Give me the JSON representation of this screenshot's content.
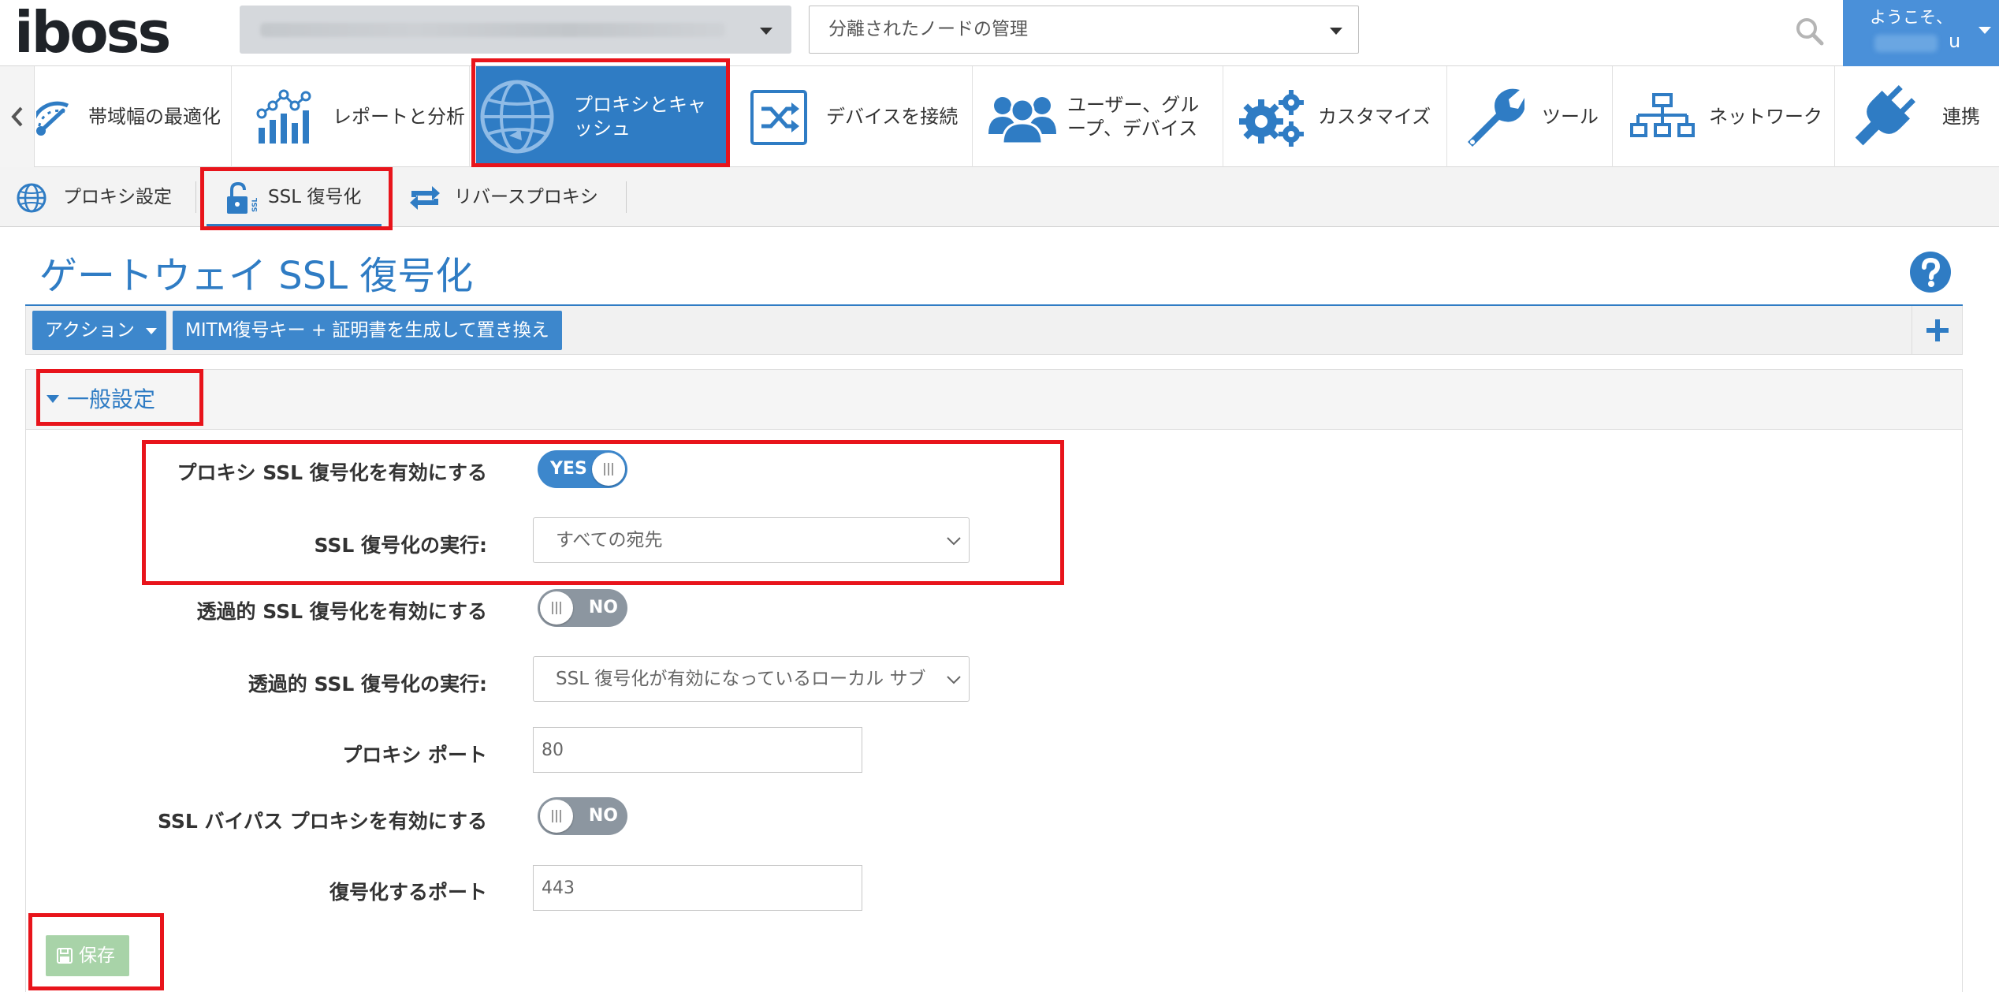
{
  "brand": {
    "logo_text": "iboss"
  },
  "header": {
    "node_select_value": "",
    "mgmt_select_value": "分離されたノードの管理",
    "welcome": "ようこそ、",
    "user_name_suffix": "u"
  },
  "main_nav": {
    "items": [
      {
        "label": "帯域幅の最適化",
        "icon": "gauge-icon"
      },
      {
        "label": "レポートと分析",
        "icon": "bar-chart-icon"
      },
      {
        "label": "プロキシとキャッシュ",
        "icon": "globe-icon",
        "active": true
      },
      {
        "label": "デバイスを接続",
        "icon": "shuffle-icon"
      },
      {
        "label": "ユーザー、グループ、デバイス",
        "icon": "users-icon"
      },
      {
        "label": "カスタマイズ",
        "icon": "gears-icon"
      },
      {
        "label": "ツール",
        "icon": "wrench-icon"
      },
      {
        "label": "ネットワーク",
        "icon": "network-icon"
      },
      {
        "label": "連携",
        "icon": "plug-icon"
      }
    ],
    "label_lines": {
      "proxy_1": "プロキシとキャ",
      "proxy_2": "ッシュ",
      "users_1": "ユーザー、グル",
      "users_2": "ープ、デバイス"
    }
  },
  "sub_nav": {
    "items": [
      {
        "label": "プロキシ設定",
        "icon": "globe-icon"
      },
      {
        "label": "SSL 復号化",
        "icon": "ssl-lock-icon",
        "active": true
      },
      {
        "label": "リバースプロキシ",
        "icon": "refresh-arrows-icon"
      }
    ]
  },
  "page": {
    "title": "ゲートウェイ SSL 復号化",
    "toolbar": {
      "actions_label": "アクション",
      "mitm_label": "MITM復号キー + 証明書を生成して置き換え"
    },
    "panel_title": "一般設定",
    "fields": {
      "proxy_ssl": {
        "label": "プロキシ SSL 復号化を有効にする",
        "toggle": "YES"
      },
      "ssl_exec": {
        "label": "SSL 復号化の実行:",
        "value": "すべての宛先"
      },
      "transparent_ssl": {
        "label": "透過的 SSL 復号化を有効にする",
        "toggle": "NO"
      },
      "transparent_exec": {
        "label": "透過的 SSL 復号化の実行:",
        "value": "SSL 復号化が有効になっているローカル サブ"
      },
      "proxy_port": {
        "label": "プロキシ ポート",
        "value": "80"
      },
      "ssl_bypass": {
        "label": "SSL バイパス プロキシを有効にする",
        "toggle": "NO"
      },
      "decrypt_port": {
        "label": "復号化するポート",
        "value": "443"
      }
    },
    "save_label": "保存"
  },
  "colors": {
    "primary": "#2f7cc4",
    "toggle_on": "#3d87cc",
    "toggle_off": "#8c96a0",
    "save_button": "#a8d3a8",
    "annotation": "#e8141b"
  }
}
